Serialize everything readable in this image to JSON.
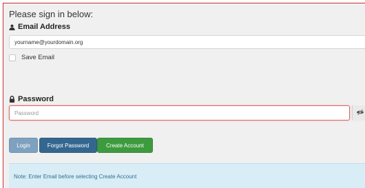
{
  "form": {
    "intro": "Please sign in below:",
    "email_label": "Email Address",
    "email_value": "yourname@yourdomain.org",
    "save_email_label": "Save Email",
    "password_label": "Password",
    "password_placeholder": "Password"
  },
  "buttons": {
    "login": "Login",
    "forgot_password": "Forgot Password",
    "create_account": "Create Account"
  },
  "note": "Note: Enter Email before selecting Create Account",
  "icons": {
    "email": "user-icon",
    "password": "lock-icon",
    "toggle": "eye-slash-icon"
  },
  "colors": {
    "panel_bg": "#f0f0f0",
    "login": "#7ea1bf",
    "forgot": "#34678f",
    "create": "#3e9a3f",
    "note_bg": "#d9edf7",
    "note_text": "#31708f",
    "error_border": "#e06666"
  }
}
